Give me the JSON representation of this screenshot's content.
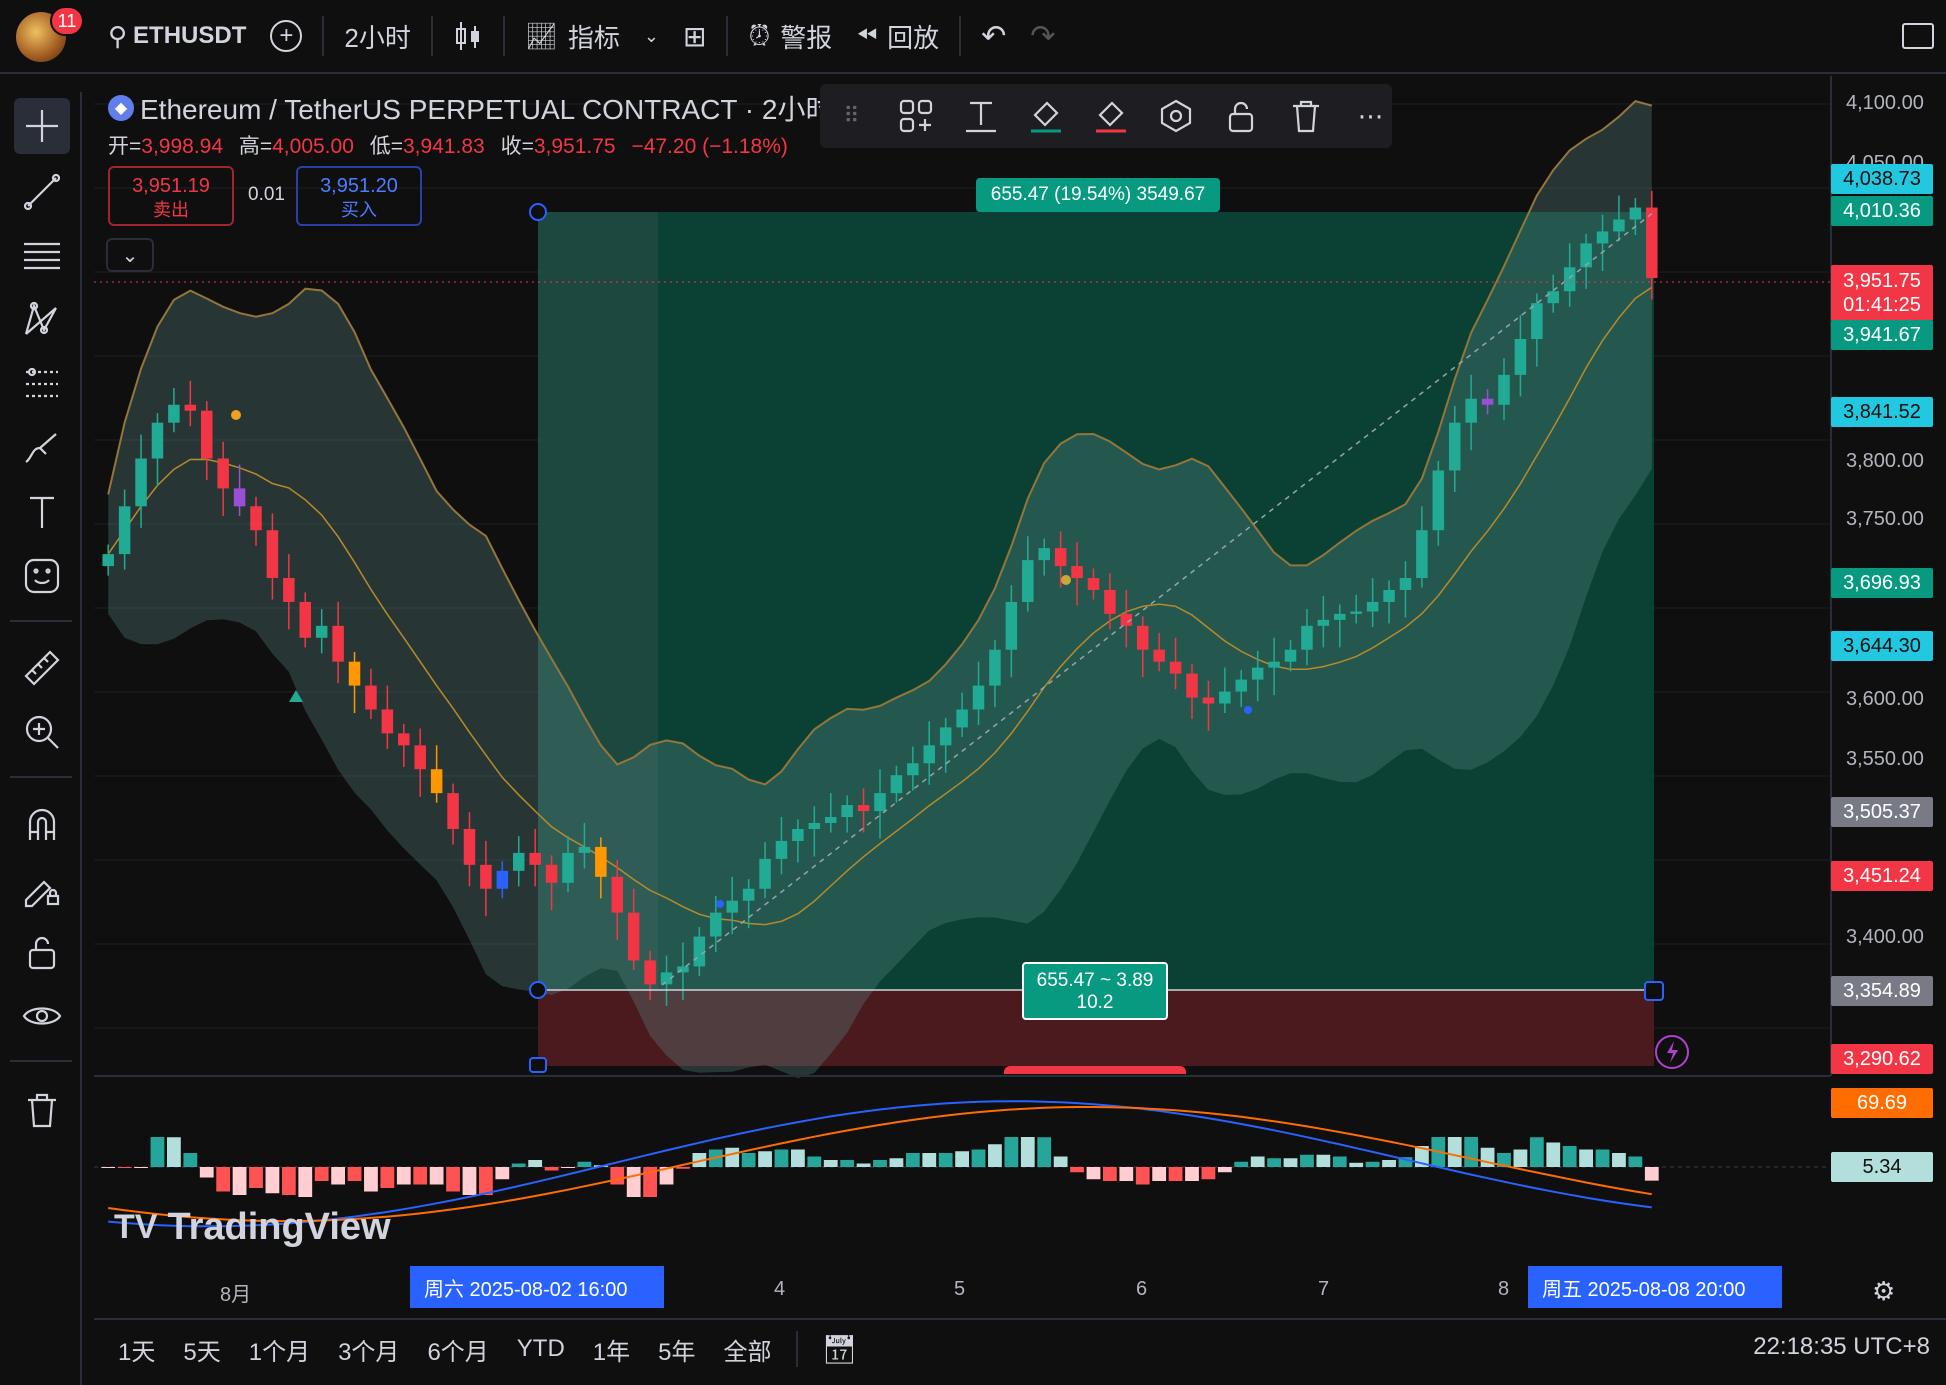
{
  "topbar": {
    "alert_count": "11",
    "symbol": "ETHUSDT",
    "interval": "2小时",
    "indicators": "指标",
    "alert": "警报",
    "replay": "回放"
  },
  "legend": {
    "title": "Ethereum / TetherUS PERPETUAL CONTRACT · 2小时 ·",
    "open_label": "开=",
    "open": "3,998.94",
    "high_label": "高=",
    "high": "4,005.00",
    "low_label": "低=",
    "low": "3,941.83",
    "close_label": "收=",
    "close": "3,951.75",
    "change": "−47.20 (−1.18%)"
  },
  "trade": {
    "sell_price": "3,951.19",
    "sell_label": "卖出",
    "spread": "0.01",
    "buy_price": "3,951.20",
    "buy_label": "买入"
  },
  "position": {
    "target_label": "655.47 (19.54%) 3549.67",
    "center_line1": "655.47 ~ 3.89",
    "center_line2": "10.2"
  },
  "price_axis": {
    "labels": [
      "4,100.00",
      "4,050.00",
      "3,800.00",
      "3,750.00",
      "3,600.00",
      "3,550.00",
      "3,400.00"
    ],
    "tags": {
      "t1": "4,038.73",
      "t2": "4,010.36",
      "t3": "3,951.75",
      "t3b": "01:41:25",
      "t4": "3,941.67",
      "t5": "3,841.52",
      "t6": "3,696.93",
      "t7": "3,644.30",
      "t8": "3,505.37",
      "t9": "3,451.24",
      "t10": "3,354.89",
      "t11": "3,290.62",
      "macd1": "69.69",
      "macd2": "5.34"
    },
    "colors": {
      "cyan": "#22c7e0",
      "green": "#089981",
      "red": "#f23645",
      "gray": "#787b86",
      "orange": "#ff6d00",
      "pale": "#b2dfdb"
    }
  },
  "time_axis": {
    "labels": [
      "8月",
      "4",
      "5",
      "6",
      "7",
      "8"
    ],
    "start_sel": "周六 2025-08-02   16:00",
    "end_sel": "周五 2025-08-08   20:00"
  },
  "ranges": [
    "1天",
    "5天",
    "1个月",
    "3个月",
    "6个月",
    "YTD",
    "1年",
    "5年",
    "全部"
  ],
  "clock": "22:18:35 UTC+8",
  "brand": "TradingView",
  "chart_data": {
    "type": "candlestick",
    "series_name": "ETHUSDT 2小时",
    "ylim": [
      3290,
      4100
    ],
    "candles": [
      3720,
      3760,
      3800,
      3830,
      3845,
      3840,
      3800,
      3775,
      3760,
      3740,
      3700,
      3680,
      3650,
      3660,
      3630,
      3610,
      3590,
      3570,
      3560,
      3540,
      3520,
      3490,
      3460,
      3440,
      3455,
      3470,
      3460,
      3445,
      3470,
      3475,
      3450,
      3420,
      3380,
      3360,
      3370,
      3375,
      3400,
      3420,
      3430,
      3440,
      3465,
      3480,
      3490,
      3495,
      3500,
      3510,
      3505,
      3520,
      3535,
      3545,
      3560,
      3575,
      3590,
      3610,
      3640,
      3680,
      3715,
      3725,
      3710,
      3700,
      3690,
      3670,
      3660,
      3640,
      3630,
      3620,
      3600,
      3595,
      3605,
      3615,
      3625,
      3630,
      3640,
      3660,
      3665,
      3670,
      3672,
      3680,
      3690,
      3700,
      3740,
      3790,
      3830,
      3850,
      3845,
      3870,
      3900,
      3930,
      3940,
      3960,
      3980,
      3990,
      4000,
      4010,
      3951
    ]
  }
}
